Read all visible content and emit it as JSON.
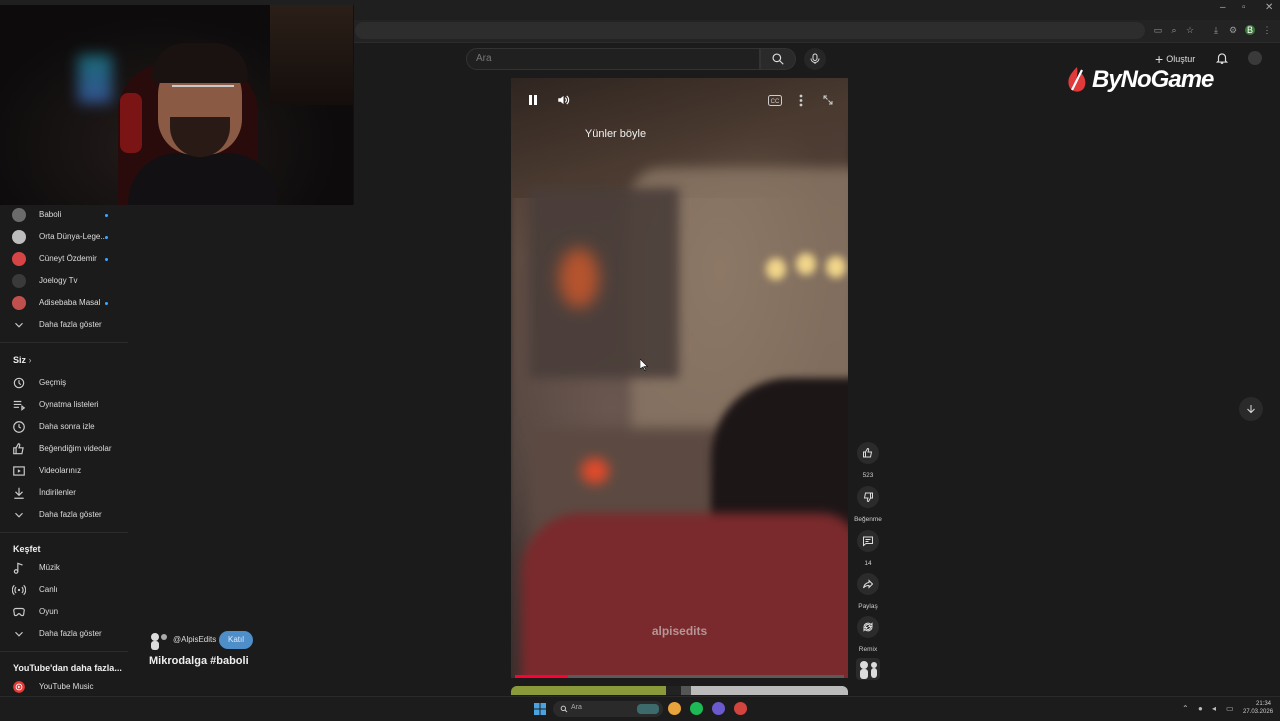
{
  "browser": {
    "window_controls": [
      "–",
      "▫",
      "✕"
    ]
  },
  "header": {
    "search_placeholder": "Ara",
    "create_label": "Oluştur"
  },
  "overlay": {
    "brand_text": "ByNoGame"
  },
  "sidebar": {
    "subscriptions": [
      {
        "label": "Baboli",
        "color": "#6b6b6b",
        "dot": true
      },
      {
        "label": "Orta Dünya-Lege...",
        "color": "#bdbdbd",
        "dot": true
      },
      {
        "label": "Cüneyt Özdemir",
        "color": "#d64545",
        "dot": true
      },
      {
        "label": "Joelogy Tv",
        "color": "#3a3a3a",
        "dot": false
      },
      {
        "label": "Adisebaba Masal",
        "color": "#c0504d",
        "dot": true
      }
    ],
    "subs_more": "Daha fazla göster",
    "you_heading": "Siz",
    "you_items": [
      {
        "label": "Geçmiş",
        "icon": "history-icon"
      },
      {
        "label": "Oynatma listeleri",
        "icon": "playlist-icon"
      },
      {
        "label": "Daha sonra izle",
        "icon": "clock-icon"
      },
      {
        "label": "Beğendiğim videolar",
        "icon": "thumbs-up-icon"
      },
      {
        "label": "Videolarınız",
        "icon": "video-icon"
      },
      {
        "label": "İndirilenler",
        "icon": "download-icon"
      }
    ],
    "you_more": "Daha fazla göster",
    "explore_heading": "Keşfet",
    "explore_items": [
      {
        "label": "Müzik",
        "icon": "music-icon"
      },
      {
        "label": "Canlı",
        "icon": "live-icon"
      },
      {
        "label": "Oyun",
        "icon": "gaming-icon"
      }
    ],
    "explore_more": "Daha fazla göster",
    "more_from_heading": "YouTube'dan daha fazla...",
    "more_from_items": [
      {
        "label": "YouTube Music",
        "icon": "youtube-music-icon"
      }
    ]
  },
  "short": {
    "caption": "Yünler böyle",
    "watermark": "alpisedits",
    "progress": 0.16,
    "channel": "@AlpisEdits",
    "subscribe_label": "Katıl",
    "title": "Mikrodalga #baboli"
  },
  "actions": {
    "like_count": "523",
    "dislike_label": "Beğenme",
    "comments_count": "14",
    "share_label": "Paylaş",
    "remix_label": "Remix"
  },
  "taskbar": {
    "search_placeholder": "Ara",
    "time": "21:34",
    "date": "27.03.2026"
  }
}
